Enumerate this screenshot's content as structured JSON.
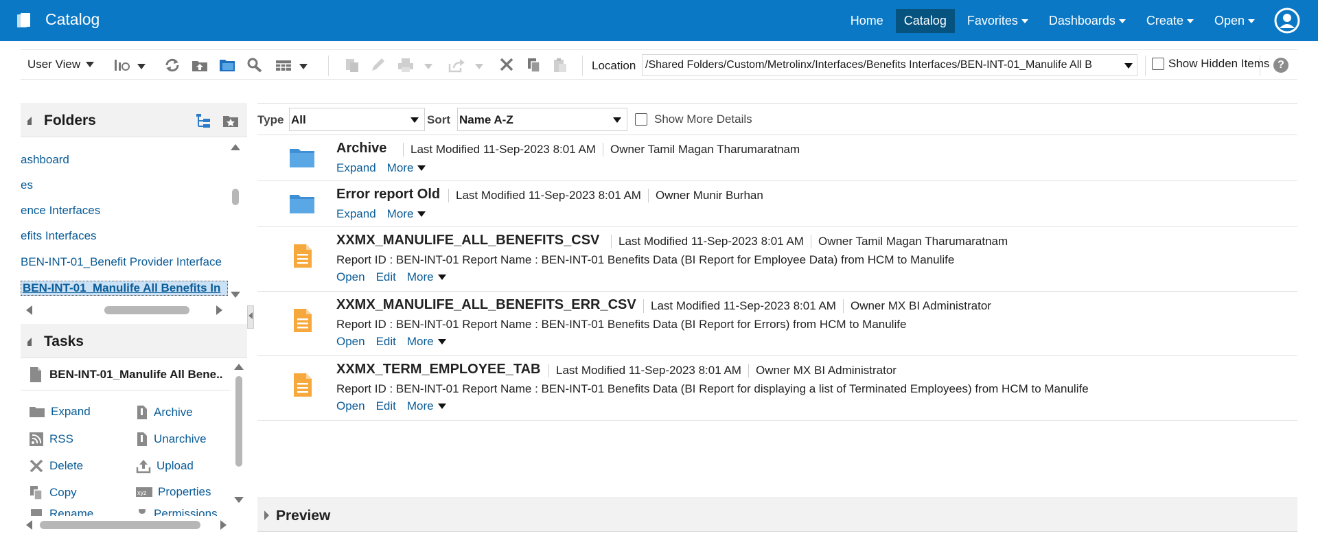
{
  "app": {
    "title": "Catalog"
  },
  "nav": {
    "home": "Home",
    "catalog": "Catalog",
    "favorites": "Favorites",
    "dashboards": "Dashboards",
    "create": "Create",
    "open": "Open"
  },
  "toolbar": {
    "user_view": "User View",
    "location_label": "Location",
    "location_value": "/Shared Folders/Custom/Metrolinx/Interfaces/Benefits Interfaces/BEN-INT-01_Manulife All B",
    "show_hidden": "Show Hidden Items"
  },
  "folders": {
    "title": "Folders",
    "items": [
      {
        "label": "ashboard"
      },
      {
        "label": "es"
      },
      {
        "label": "ence Interfaces"
      },
      {
        "label": "efits Interfaces"
      },
      {
        "label": "BEN-INT-01_Benefit Provider Interface"
      },
      {
        "label": "BEN-INT-01_Manulife All Benefits In"
      }
    ]
  },
  "tasks": {
    "title": "Tasks",
    "selected": "BEN-INT-01_Manulife All Bene..",
    "items": {
      "expand": "Expand",
      "archive": "Archive",
      "rss": "RSS",
      "unarchive": "Unarchive",
      "delete": "Delete",
      "upload": "Upload",
      "copy": "Copy",
      "properties": "Properties",
      "rename": "Rename",
      "permissions": "Permissions"
    }
  },
  "filter": {
    "type_label": "Type",
    "type_value": "All",
    "sort_label": "Sort",
    "sort_value": "Name A-Z",
    "more_details": "Show More Details"
  },
  "items": [
    {
      "name": "Archive",
      "modified": "Last Modified 11-Sep-2023 8:01 AM",
      "owner": "Owner Tamil Magan Tharumaratnam",
      "desc": "",
      "actions": [
        "Expand"
      ],
      "more": "More",
      "kind": "folder"
    },
    {
      "name": "Error report Old",
      "modified": "Last Modified 11-Sep-2023 8:01 AM",
      "owner": "Owner Munir Burhan",
      "desc": "",
      "actions": [
        "Expand"
      ],
      "more": "More",
      "kind": "folder"
    },
    {
      "name": "XXMX_MANULIFE_ALL_BENEFITS_CSV",
      "modified": "Last Modified 11-Sep-2023 8:01 AM",
      "owner": "Owner Tamil Magan Tharumaratnam",
      "desc": "Report ID : BEN-INT-01 Report Name : BEN-INT-01 Benefits Data (BI Report for Employee Data) from HCM to Manulife",
      "actions": [
        "Open",
        "Edit"
      ],
      "more": "More",
      "kind": "report"
    },
    {
      "name": "XXMX_MANULIFE_ALL_BENEFITS_ERR_CSV",
      "modified": "Last Modified 11-Sep-2023 8:01 AM",
      "owner": "Owner MX BI Administrator",
      "desc": "Report ID : BEN-INT-01 Report Name : BEN-INT-01 Benefits Data (BI Report for Errors) from HCM to Manulife",
      "actions": [
        "Open",
        "Edit"
      ],
      "more": "More",
      "kind": "report"
    },
    {
      "name": "XXMX_TERM_EMPLOYEE_TAB",
      "modified": "Last Modified 11-Sep-2023 8:01 AM",
      "owner": "Owner MX BI Administrator",
      "desc": "Report ID : BEN-INT-01 Report Name : BEN-INT-01 Benefits Data (BI Report for displaying a list of Terminated Employees) from HCM to Manulife",
      "actions": [
        "Open",
        "Edit"
      ],
      "more": "More",
      "kind": "report"
    }
  ],
  "preview": {
    "label": "Preview"
  },
  "colors": {
    "brand": "#0a78c4",
    "link": "#0a5c97",
    "folder": "#5aa7e6",
    "report": "#f7a83c"
  }
}
